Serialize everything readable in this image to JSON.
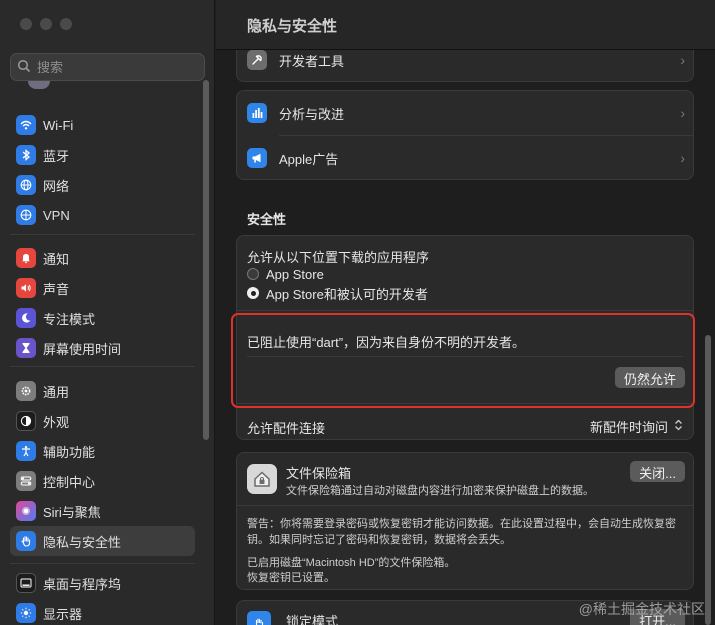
{
  "sidebar": {
    "search_placeholder": "搜索",
    "items": [
      {
        "label": "Wi-Fi",
        "icon": "wifi-icon",
        "color": "#2f7ce6"
      },
      {
        "label": "蓝牙",
        "icon": "bluetooth-icon",
        "color": "#2f7ce6"
      },
      {
        "label": "网络",
        "icon": "globe-icon",
        "color": "#2f7ce6"
      },
      {
        "label": "VPN",
        "icon": "vpn-icon",
        "color": "#2f7ce6"
      },
      {
        "label": "通知",
        "icon": "bell-icon",
        "color": "#e5473f"
      },
      {
        "label": "声音",
        "icon": "speaker-icon",
        "color": "#e5473f"
      },
      {
        "label": "专注模式",
        "icon": "moon-icon",
        "color": "#5b55d6"
      },
      {
        "label": "屏幕使用时间",
        "icon": "hourglass-icon",
        "color": "#6a54c8"
      },
      {
        "label": "通用",
        "icon": "gear-icon",
        "color": "#7d7d7d"
      },
      {
        "label": "外观",
        "icon": "appearance-icon",
        "color": "#1c1c1c"
      },
      {
        "label": "辅助功能",
        "icon": "accessibility-icon",
        "color": "#2f7ce6"
      },
      {
        "label": "控制中心",
        "icon": "control-center-icon",
        "color": "#7d7d7d"
      },
      {
        "label": "Siri与聚焦",
        "icon": "siri-icon",
        "color": "#8a4fd0"
      },
      {
        "label": "隐私与安全性",
        "icon": "hand-icon",
        "color": "#2f7ce6"
      },
      {
        "label": "桌面与程序坞",
        "icon": "dock-icon",
        "color": "#1c1c1c"
      },
      {
        "label": "显示器",
        "icon": "display-icon",
        "color": "#2f7ce6"
      }
    ]
  },
  "main": {
    "title": "隐私与安全性",
    "rows": {
      "developer_tools": "开发者工具",
      "analytics": "分析与改进",
      "apple_ads": "Apple广告"
    },
    "security": {
      "section_title": "安全性",
      "allow_from_label": "允许从以下位置下载的应用程序",
      "options": [
        "App Store",
        "App Store和被认可的开发者"
      ],
      "selected_index": 1,
      "blocked_message": "已阻止使用“dart”，因为来自身份不明的开发者。",
      "allow_anyway_button": "仍然允许",
      "accessory_label": "允许配件连接",
      "accessory_value": "新配件时询问",
      "filevault_title": "文件保险箱",
      "filevault_desc": "文件保险箱通过自动对磁盘内容进行加密来保护磁盘上的数据。",
      "filevault_button": "关闭...",
      "filevault_warning": "警告：你将需要登录密码或恢复密钥才能访问数据。在此设置过程中，会自动生成恢复密钥。如果同时忘记了密码和恢复密钥，数据将会丢失。",
      "filevault_status_1": "已启用磁盘“Macintosh HD”的文件保险箱。",
      "filevault_status_2": "恢复密钥已设置。",
      "lockdown_title": "锁定模式",
      "lockdown_button": "打开..."
    }
  },
  "watermark": "@稀土掘金技术社区"
}
